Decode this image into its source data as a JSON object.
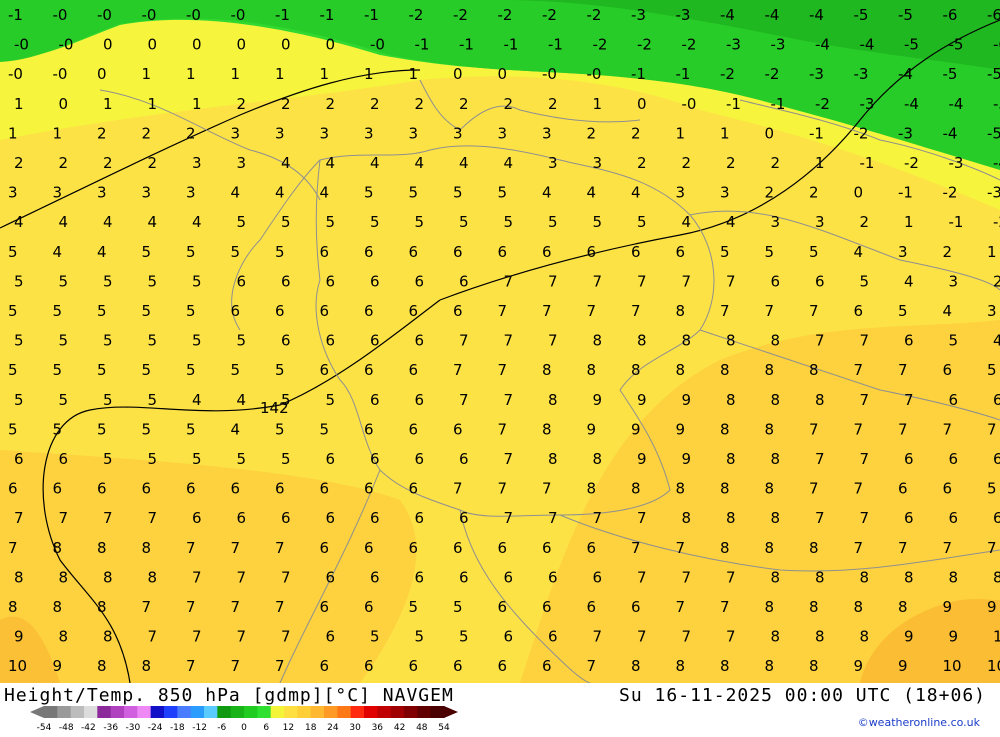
{
  "title": "Height/Temp. 850 hPa [gdmp][°C] NAVGEM",
  "datetime": "Su 16-11-2025 00:00 UTC (18+06)",
  "credit": "©weatheronline.co.uk",
  "contour_label": "142",
  "legend": {
    "ticks": [
      "-54",
      "-48",
      "-42",
      "-36",
      "-30",
      "-24",
      "-18",
      "-12",
      "-6",
      "0",
      "6",
      "12",
      "18",
      "24",
      "30",
      "36",
      "42",
      "48",
      "54"
    ],
    "colors": [
      "#787878",
      "#9a9a9a",
      "#bcbcbc",
      "#dcdcdc",
      "#8c2a9c",
      "#b042c0",
      "#d060e0",
      "#ee88f4",
      "#1010c8",
      "#2040ff",
      "#4a7cff",
      "#2a9cff",
      "#5acbff",
      "#109a10",
      "#18b418",
      "#20cc20",
      "#30e030",
      "#f4f43a",
      "#ffe040",
      "#ffcf38",
      "#ffb830",
      "#ff9a24",
      "#ff7818",
      "#ff2a10",
      "#e00000",
      "#c00000",
      "#a00000",
      "#800000",
      "#600000",
      "#4a0000"
    ]
  },
  "temperature_values": [
    [
      "-1",
      "-0",
      "-0",
      "-0",
      "-0",
      "-0",
      "-1",
      "-1",
      "-1",
      "-2",
      "-2",
      "-2",
      "-2",
      "-2",
      "-3",
      "-3",
      "-4",
      "-4",
      "-4",
      "-5",
      "-5",
      "-6",
      "-6"
    ],
    [
      "-0",
      "-0",
      "0",
      "0",
      "0",
      "0",
      "0",
      "0",
      "-0",
      "-1",
      "-1",
      "-1",
      "-1",
      "-2",
      "-2",
      "-2",
      "-3",
      "-3",
      "-4",
      "-4",
      "-5",
      "-5",
      "-6"
    ],
    [
      "-0",
      "-0",
      "0",
      "1",
      "1",
      "1",
      "1",
      "1",
      "1",
      "1",
      "0",
      "0",
      "-0",
      "-0",
      "-1",
      "-1",
      "-2",
      "-2",
      "-3",
      "-3",
      "-4",
      "-5",
      "-5"
    ],
    [
      "1",
      "0",
      "1",
      "1",
      "1",
      "2",
      "2",
      "2",
      "2",
      "2",
      "2",
      "2",
      "2",
      "1",
      "0",
      "-0",
      "-1",
      "-1",
      "-2",
      "-3",
      "-4",
      "-4",
      "-5"
    ],
    [
      "1",
      "1",
      "2",
      "2",
      "2",
      "3",
      "3",
      "3",
      "3",
      "3",
      "3",
      "3",
      "3",
      "2",
      "2",
      "1",
      "1",
      "0",
      "-1",
      "-2",
      "-3",
      "-4",
      "-5"
    ],
    [
      "2",
      "2",
      "2",
      "2",
      "3",
      "3",
      "4",
      "4",
      "4",
      "4",
      "4",
      "4",
      "3",
      "3",
      "2",
      "2",
      "2",
      "2",
      "1",
      "-1",
      "-2",
      "-3",
      "-4"
    ],
    [
      "3",
      "3",
      "3",
      "3",
      "3",
      "4",
      "4",
      "4",
      "5",
      "5",
      "5",
      "5",
      "4",
      "4",
      "4",
      "3",
      "3",
      "2",
      "2",
      "0",
      "-1",
      "-2",
      "-3"
    ],
    [
      "4",
      "4",
      "4",
      "4",
      "4",
      "5",
      "5",
      "5",
      "5",
      "5",
      "5",
      "5",
      "5",
      "5",
      "5",
      "4",
      "4",
      "3",
      "3",
      "2",
      "1",
      "-1",
      "-2"
    ],
    [
      "5",
      "4",
      "4",
      "5",
      "5",
      "5",
      "5",
      "6",
      "6",
      "6",
      "6",
      "6",
      "6",
      "6",
      "6",
      "6",
      "5",
      "5",
      "5",
      "4",
      "3",
      "2",
      "1"
    ],
    [
      "5",
      "5",
      "5",
      "5",
      "5",
      "6",
      "6",
      "6",
      "6",
      "6",
      "6",
      "7",
      "7",
      "7",
      "7",
      "7",
      "7",
      "6",
      "6",
      "5",
      "4",
      "3",
      "2"
    ],
    [
      "5",
      "5",
      "5",
      "5",
      "5",
      "6",
      "6",
      "6",
      "6",
      "6",
      "6",
      "7",
      "7",
      "7",
      "7",
      "8",
      "7",
      "7",
      "7",
      "6",
      "5",
      "4",
      "3"
    ],
    [
      "5",
      "5",
      "5",
      "5",
      "5",
      "5",
      "6",
      "6",
      "6",
      "6",
      "7",
      "7",
      "7",
      "8",
      "8",
      "8",
      "8",
      "8",
      "7",
      "7",
      "6",
      "5",
      "4"
    ],
    [
      "5",
      "5",
      "5",
      "5",
      "5",
      "5",
      "5",
      "6",
      "6",
      "6",
      "7",
      "7",
      "8",
      "8",
      "8",
      "8",
      "8",
      "8",
      "8",
      "7",
      "7",
      "6",
      "5"
    ],
    [
      "5",
      "5",
      "5",
      "5",
      "4",
      "4",
      "5",
      "5",
      "6",
      "6",
      "7",
      "7",
      "8",
      "9",
      "9",
      "9",
      "8",
      "8",
      "8",
      "7",
      "7",
      "6",
      "6"
    ],
    [
      "5",
      "5",
      "5",
      "5",
      "5",
      "4",
      "5",
      "5",
      "6",
      "6",
      "6",
      "7",
      "8",
      "9",
      "9",
      "9",
      "8",
      "8",
      "7",
      "7",
      "7",
      "7",
      "7"
    ],
    [
      "6",
      "6",
      "5",
      "5",
      "5",
      "5",
      "5",
      "6",
      "6",
      "6",
      "6",
      "7",
      "8",
      "8",
      "9",
      "9",
      "8",
      "8",
      "7",
      "7",
      "6",
      "6",
      "6"
    ],
    [
      "6",
      "6",
      "6",
      "6",
      "6",
      "6",
      "6",
      "6",
      "6",
      "6",
      "7",
      "7",
      "7",
      "8",
      "8",
      "8",
      "8",
      "8",
      "7",
      "7",
      "6",
      "6",
      "5"
    ],
    [
      "7",
      "7",
      "7",
      "7",
      "6",
      "6",
      "6",
      "6",
      "6",
      "6",
      "6",
      "7",
      "7",
      "7",
      "7",
      "8",
      "8",
      "8",
      "7",
      "7",
      "6",
      "6",
      "6"
    ],
    [
      "7",
      "8",
      "8",
      "8",
      "7",
      "7",
      "7",
      "6",
      "6",
      "6",
      "6",
      "6",
      "6",
      "6",
      "7",
      "7",
      "8",
      "8",
      "8",
      "7",
      "7",
      "7",
      "7"
    ],
    [
      "8",
      "8",
      "8",
      "8",
      "7",
      "7",
      "7",
      "6",
      "6",
      "6",
      "6",
      "6",
      "6",
      "6",
      "7",
      "7",
      "7",
      "8",
      "8",
      "8",
      "8",
      "8",
      "8"
    ],
    [
      "8",
      "8",
      "8",
      "7",
      "7",
      "7",
      "7",
      "6",
      "6",
      "5",
      "5",
      "6",
      "6",
      "6",
      "6",
      "7",
      "7",
      "8",
      "8",
      "8",
      "8",
      "9",
      "9"
    ],
    [
      "9",
      "8",
      "8",
      "7",
      "7",
      "7",
      "7",
      "6",
      "5",
      "5",
      "5",
      "6",
      "6",
      "7",
      "7",
      "7",
      "7",
      "8",
      "8",
      "8",
      "9",
      "9",
      "10"
    ],
    [
      "10",
      "9",
      "8",
      "8",
      "7",
      "7",
      "7",
      "6",
      "6",
      "6",
      "6",
      "6",
      "6",
      "7",
      "8",
      "8",
      "8",
      "8",
      "8",
      "9",
      "9",
      "10",
      "10"
    ]
  ]
}
